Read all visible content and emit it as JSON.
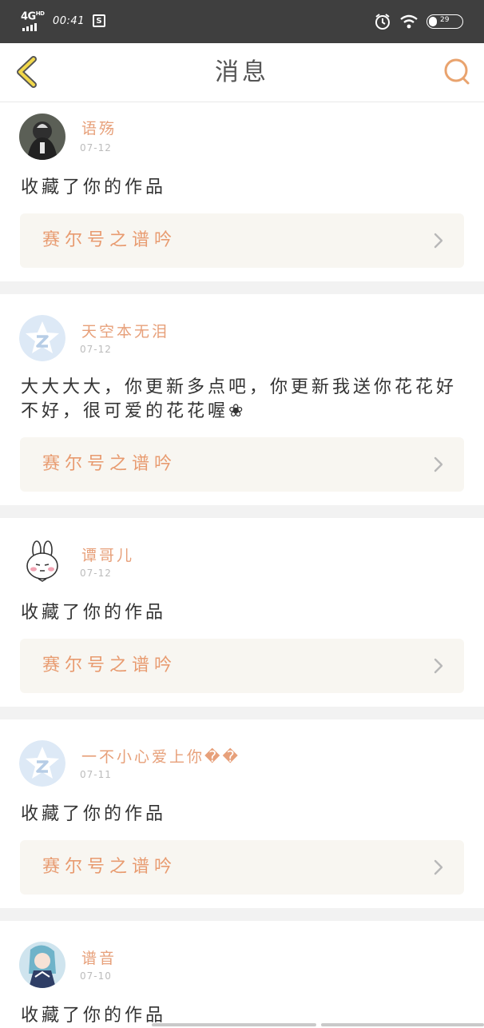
{
  "status_bar": {
    "network": "4G",
    "network_sup": "HD",
    "time": "00:41",
    "sim_icon_label": "S",
    "battery_level": "29",
    "icons": [
      "signal-icon",
      "sim-icon",
      "alarm-icon",
      "wifi-icon",
      "battery-icon"
    ]
  },
  "nav": {
    "title": "消息",
    "back_icon": "back-chevron-icon",
    "search_icon": "search-icon",
    "accent_color": "#e9a36e"
  },
  "messages": [
    {
      "username": "语殇",
      "date": "07-12",
      "text": "收藏了你的作品",
      "work_title": "赛尔号之谱吟",
      "avatar": "dark-character-avatar"
    },
    {
      "username": "天空本无泪",
      "date": "07-12",
      "text": "大大大大，你更新多点吧，你更新我送你花花好不好，很可爱的花花喔",
      "text_emoji": "❀",
      "work_title": "赛尔号之谱吟",
      "avatar": "qzone-default-avatar"
    },
    {
      "username": "谭哥儿",
      "date": "07-12",
      "text": "收藏了你的作品",
      "work_title": "赛尔号之谱吟",
      "avatar": "bunny-avatar"
    },
    {
      "username": "一不小心爱上你��",
      "date": "07-11",
      "text": "收藏了你的作品",
      "work_title": "赛尔号之谱吟",
      "avatar": "qzone-default-avatar"
    },
    {
      "username": "谱音",
      "date": "07-10",
      "text": "收藏了你的作品",
      "work_title": "",
      "avatar": "anime-character-avatar"
    }
  ]
}
